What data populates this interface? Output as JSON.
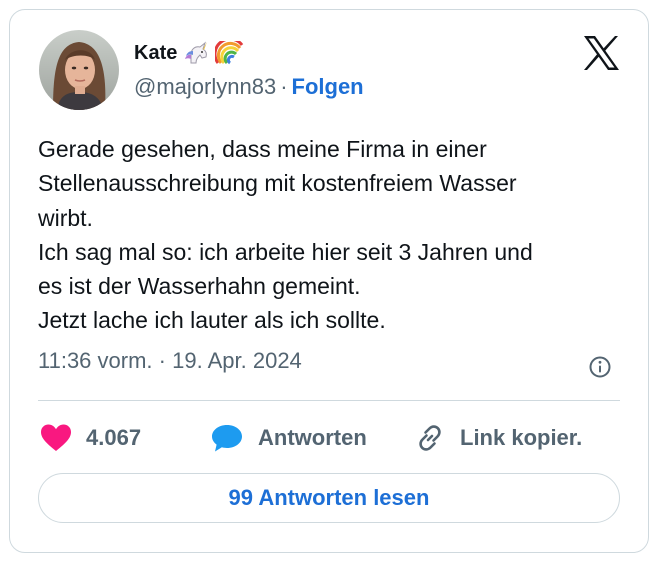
{
  "author": {
    "display_name": "Kate",
    "name_emojis": [
      "unicorn-icon",
      "rainbow-icon"
    ],
    "handle": "@majorlynn83",
    "separator": "·",
    "follow_label": "Folgen"
  },
  "tweet": {
    "lines": [
      "Gerade gesehen, dass meine Firma in einer",
      "Stellenausschreibung mit kostenfreiem Wasser",
      "wirbt.",
      "Ich sag mal so: ich arbeite hier seit 3 Jahren und",
      "es ist der Wasserhahn gemeint.",
      "Jetzt lache ich lauter als ich sollte."
    ],
    "time": "11:36 vorm.",
    "separator": "·",
    "date": "19. Apr. 2024"
  },
  "actions": {
    "like_count": "4.067",
    "reply_label": "Antworten",
    "copy_link_label": "Link kopier."
  },
  "footer": {
    "read_replies_label": "99 Antworten lesen"
  },
  "colors": {
    "like": "#f91880",
    "reply": "#1d9bf0",
    "link": "#1d6fd6",
    "secondary_text": "#536471",
    "border": "#cfd9de"
  }
}
